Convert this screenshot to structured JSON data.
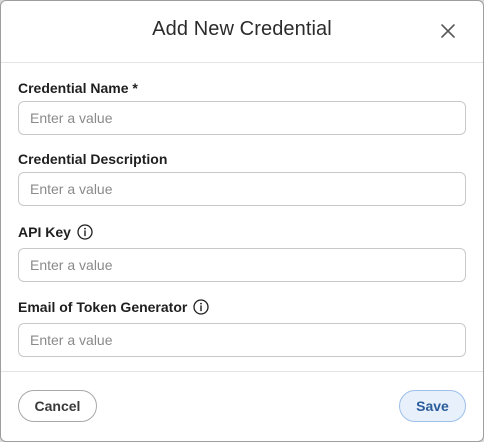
{
  "dialog": {
    "title": "Add New Credential",
    "close_icon": "close-icon"
  },
  "fields": [
    {
      "label": "Credential Name *",
      "placeholder": "Enter a value",
      "value": "",
      "info_icon": false
    },
    {
      "label": "Credential Description",
      "placeholder": "Enter a value",
      "value": "",
      "info_icon": false
    },
    {
      "label": "API Key",
      "placeholder": "Enter a value",
      "value": "",
      "info_icon": true
    },
    {
      "label": "Email of Token Generator",
      "placeholder": "Enter a value",
      "value": "",
      "info_icon": true
    }
  ],
  "footer": {
    "cancel_label": "Cancel",
    "save_label": "Save"
  },
  "colors": {
    "save_background": "#e7f0fb",
    "save_border": "#9cc0ea",
    "save_text": "#2b5d9b",
    "input_border": "#c9c9c9"
  }
}
